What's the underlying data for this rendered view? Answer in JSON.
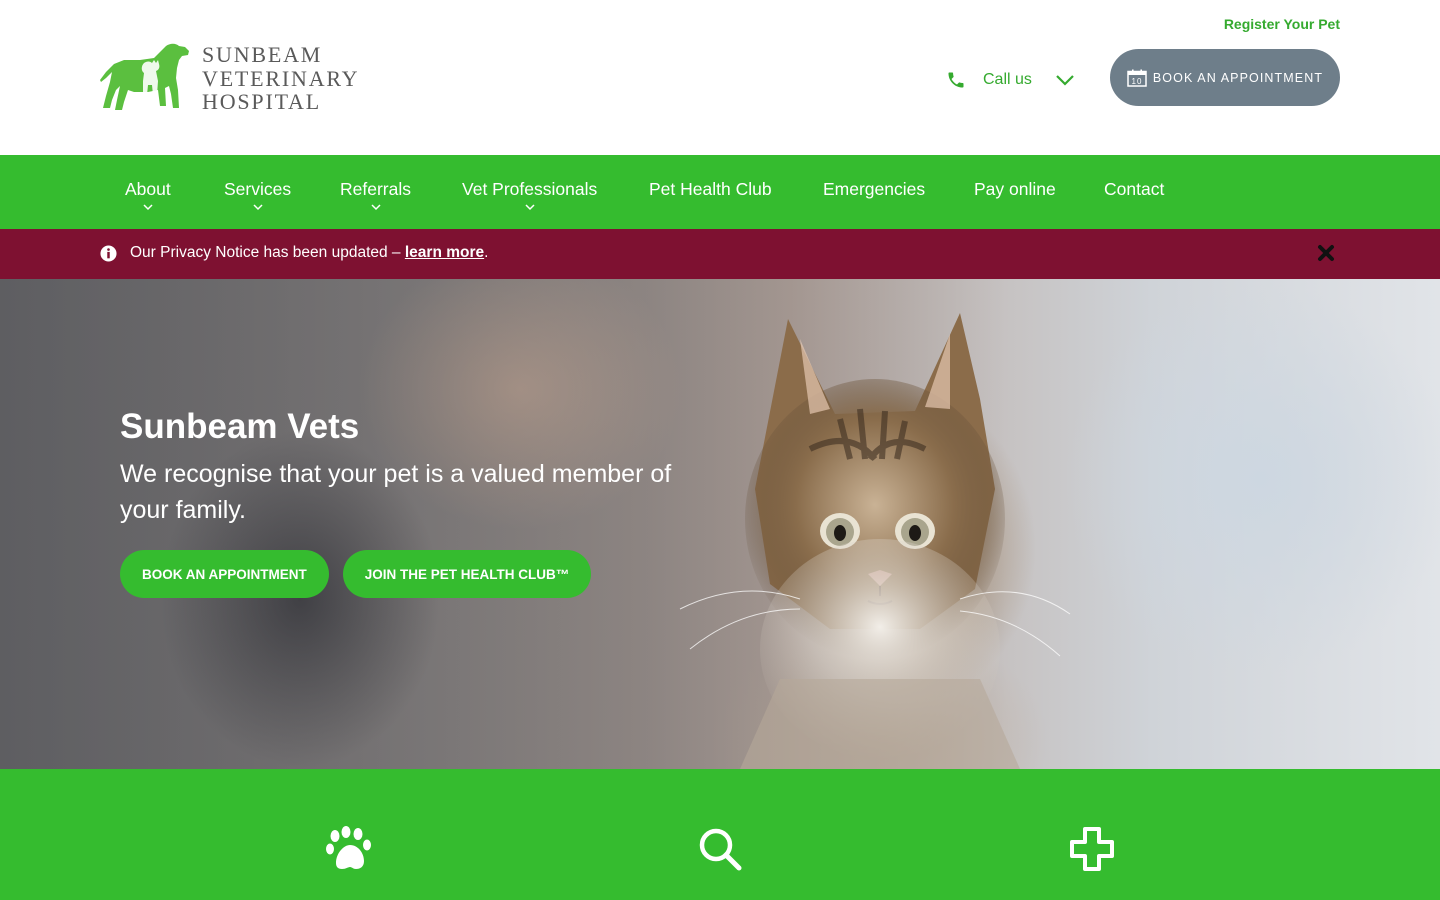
{
  "brand": {
    "name_lines": [
      "SUNBEAM",
      "VETERINARY",
      "HOSPITAL"
    ],
    "accent_color": "#35bc2f",
    "notice_color": "#7e1131"
  },
  "header": {
    "register_link": "Register Your Pet",
    "call_label": "Call us",
    "book_button": "BOOK AN APPOINTMENT",
    "calendar_day": "10"
  },
  "nav": {
    "items": [
      {
        "label": "About",
        "has_dropdown": true
      },
      {
        "label": "Services",
        "has_dropdown": true
      },
      {
        "label": "Referrals",
        "has_dropdown": true
      },
      {
        "label": "Vet Professionals",
        "has_dropdown": true
      },
      {
        "label": "Pet Health Club",
        "has_dropdown": false
      },
      {
        "label": "Emergencies",
        "has_dropdown": false
      },
      {
        "label": "Pay online",
        "has_dropdown": false
      },
      {
        "label": "Contact",
        "has_dropdown": false
      }
    ]
  },
  "notice": {
    "text": "Our Privacy Notice has been updated – ",
    "link": "learn more",
    "suffix": "."
  },
  "hero": {
    "title": "Sunbeam Vets",
    "subtitle": "We recognise that your pet is a valued member of your family.",
    "primary_button": "BOOK AN APPOINTMENT",
    "secondary_button": "JOIN THE PET HEALTH CLUB™"
  },
  "features": {
    "icons": [
      "paw-icon",
      "search-icon",
      "medical-cross-icon"
    ]
  }
}
